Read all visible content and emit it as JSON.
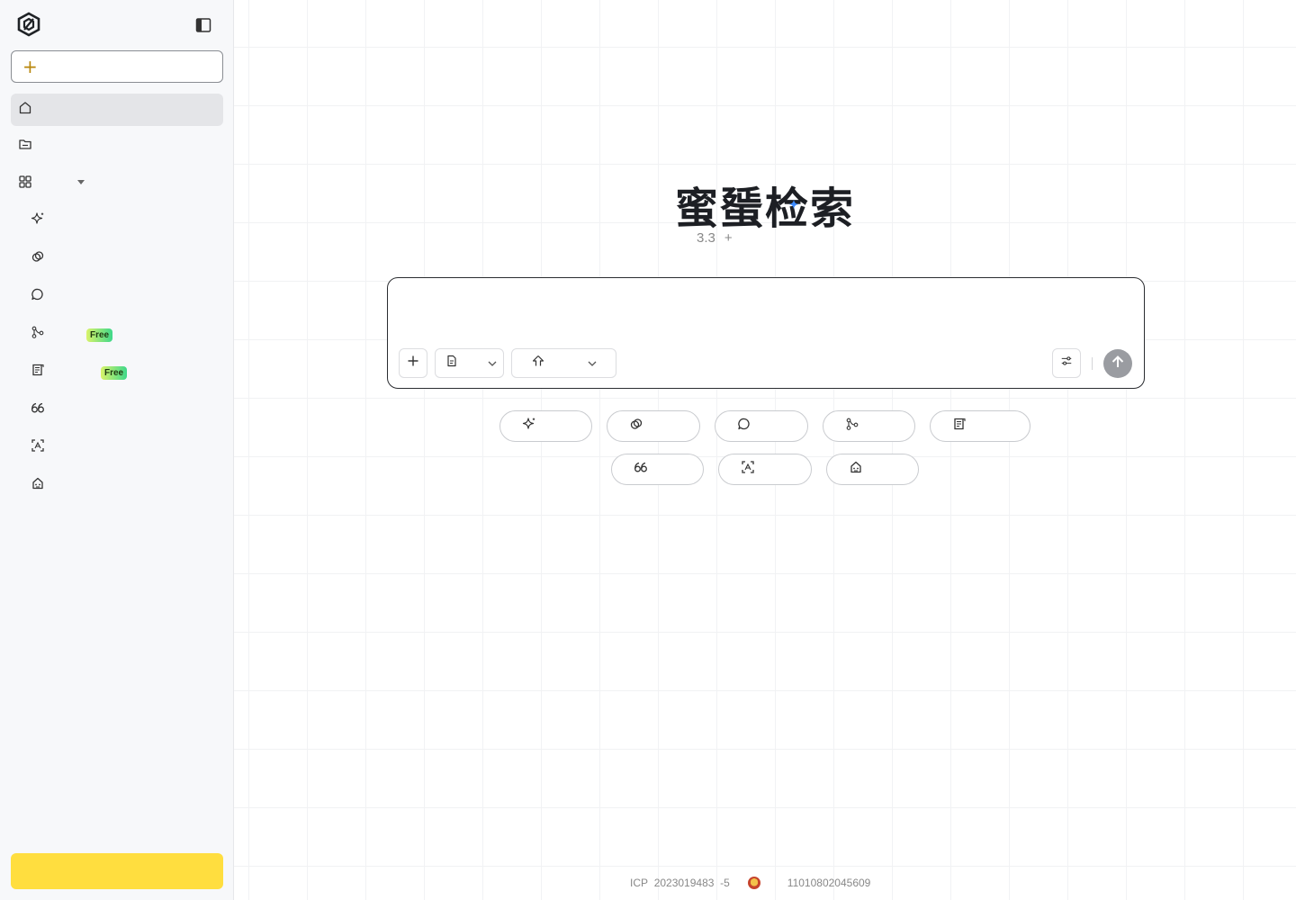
{
  "sidebar": {
    "new_chat_icon": "plus",
    "nav": [
      {
        "id": "home",
        "icon": "home-icon",
        "active": true
      },
      {
        "id": "files",
        "icon": "folder-icon"
      },
      {
        "id": "apps",
        "icon": "grid-icon",
        "expandable": true
      }
    ],
    "tools": [
      {
        "id": "ai-search",
        "icon": "sparkle-icon"
      },
      {
        "id": "links",
        "icon": "link-icon"
      },
      {
        "id": "chat",
        "icon": "chat-icon"
      },
      {
        "id": "mindmap",
        "icon": "branch-icon",
        "badge": "Free"
      },
      {
        "id": "report",
        "icon": "scroll-icon",
        "badge": "Free"
      },
      {
        "id": "quote",
        "icon": "quote-icon"
      },
      {
        "id": "scan",
        "icon": "scan-icon"
      },
      {
        "id": "robot",
        "icon": "robot-icon"
      }
    ]
  },
  "main": {
    "title": "蜜蜑检索",
    "version": "3.3",
    "version_plus": "+",
    "input_placeholder": "",
    "quick_chips": [
      {
        "icon": "sparkle-icon"
      },
      {
        "icon": "link-icon"
      },
      {
        "icon": "chat-icon"
      },
      {
        "icon": "branch-icon"
      },
      {
        "icon": "scroll-icon"
      },
      {
        "icon": "quote-icon"
      },
      {
        "icon": "scan-icon"
      },
      {
        "icon": "robot-icon"
      }
    ]
  },
  "footer": {
    "icp_label": "ICP",
    "icp_number": "2023019483",
    "icp_suffix": "-5",
    "police_number": "11010802045609"
  },
  "colors": {
    "accent_yellow": "#ffde3f",
    "free_badge": "#3ed88a",
    "send_button": "#9a9ca1"
  }
}
